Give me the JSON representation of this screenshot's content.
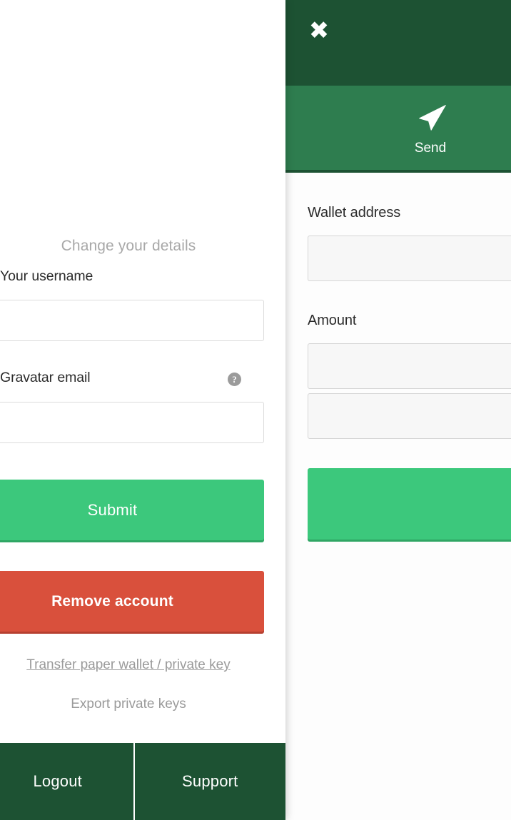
{
  "account_panel": {
    "section_title": "Change your details",
    "username_label": "Your username",
    "username_value": "",
    "username_placeholder": "",
    "gravatar_label": "Gravatar email",
    "gravatar_value": "",
    "gravatar_placeholder": "",
    "help_icon_glyph": "?",
    "submit_label": "Submit",
    "remove_label": "Remove account",
    "transfer_link": "Transfer paper wallet / private key",
    "export_link": "Export private keys"
  },
  "footer": {
    "logout_label": "Logout",
    "support_label": "Support"
  },
  "send_drawer": {
    "close_glyph": "✖",
    "tab_label": "Send",
    "wallet_label": "Wallet address",
    "wallet_value": "",
    "wallet_placeholder": "",
    "amount_label": "Amount",
    "amount_value": "",
    "amount_placeholder": "",
    "currency_value": "",
    "currency_placeholder": "",
    "send_button_label": ""
  },
  "colors": {
    "dark_green": "#1d5233",
    "mid_green": "#2e7d4f",
    "bright_green": "#3cc87c",
    "danger_red": "#d9503c",
    "muted_gray": "#9a9a9a",
    "input_fill": "#f7f7f7"
  }
}
